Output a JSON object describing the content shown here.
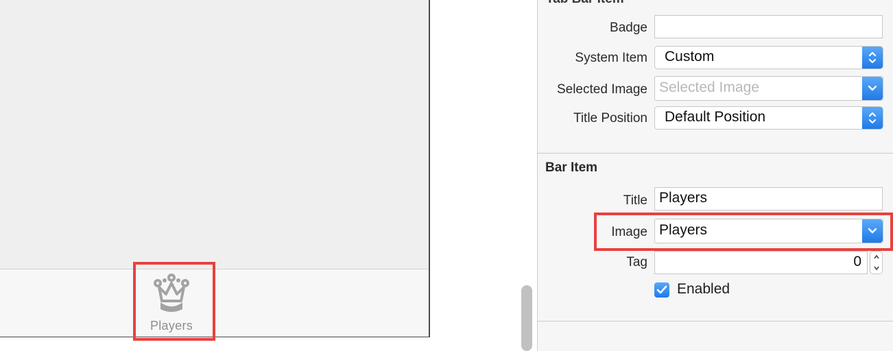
{
  "canvas": {
    "tab_bar": {
      "item_label": "Players",
      "item_icon": "crown-icon"
    }
  },
  "inspector": {
    "tab_bar_item_section": {
      "badge_label": "Badge",
      "badge_value": "",
      "system_item_label": "System Item",
      "system_item_value": "Custom",
      "selected_image_label": "Selected Image",
      "selected_image_placeholder": "Selected Image",
      "title_position_label": "Title Position",
      "title_position_value": "Default Position"
    },
    "bar_item_section": {
      "heading": "Bar Item",
      "title_label": "Title",
      "title_value": "Players",
      "image_label": "Image",
      "image_value": "Players",
      "tag_label": "Tag",
      "tag_value": "0",
      "enabled_label": "Enabled",
      "enabled_checked": true
    }
  },
  "colors": {
    "highlight": "#e8413f",
    "accent": "#1f7ae8"
  }
}
